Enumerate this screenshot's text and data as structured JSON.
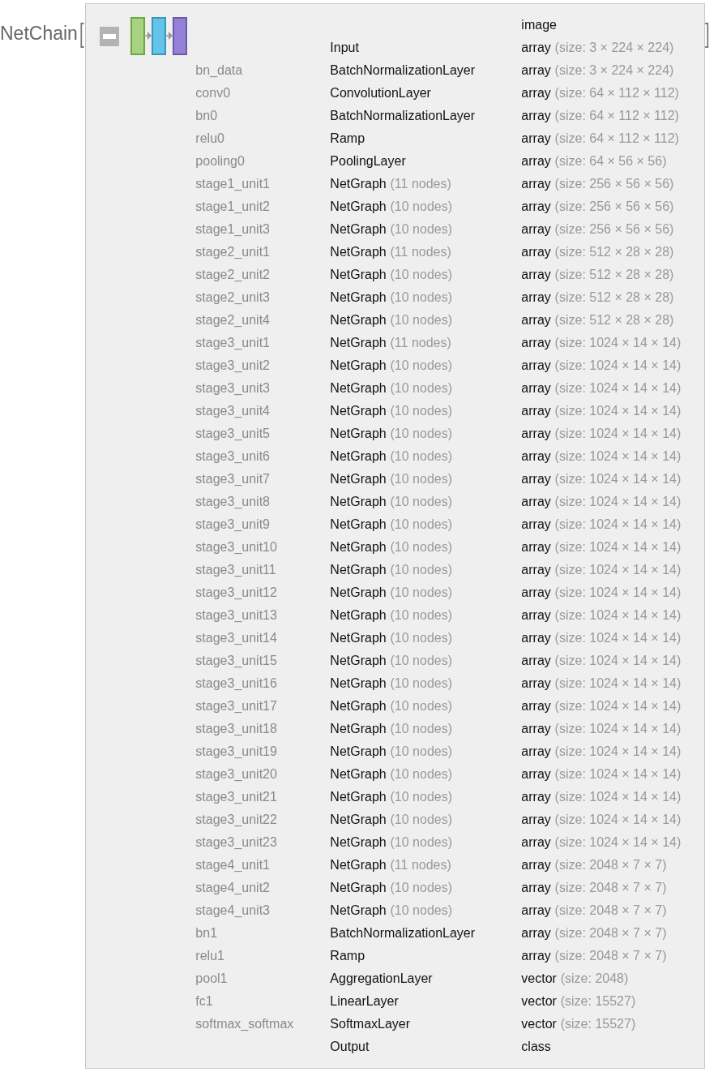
{
  "title": "NetChain",
  "open_bracket": "[",
  "close_bracket": "]",
  "expanded": true,
  "rows": [
    {
      "shape": "image"
    },
    {
      "type": "Input",
      "shape": "array",
      "shape_note": "(size: 3 × 224 × 224)"
    },
    {
      "name": "bn_data",
      "type": "BatchNormalizationLayer",
      "shape": "array",
      "shape_note": "(size: 3 × 224 × 224)"
    },
    {
      "name": "conv0",
      "type": "ConvolutionLayer",
      "shape": "array",
      "shape_note": "(size: 64 × 112 × 112)"
    },
    {
      "name": "bn0",
      "type": "BatchNormalizationLayer",
      "shape": "array",
      "shape_note": "(size: 64 × 112 × 112)"
    },
    {
      "name": "relu0",
      "type": "Ramp",
      "shape": "array",
      "shape_note": "(size: 64 × 112 × 112)"
    },
    {
      "name": "pooling0",
      "type": "PoolingLayer",
      "shape": "array",
      "shape_note": "(size: 64 × 56 × 56)"
    },
    {
      "name": "stage1_unit1",
      "type": "NetGraph",
      "type_note": "(11 nodes)",
      "shape": "array",
      "shape_note": "(size: 256 × 56 × 56)"
    },
    {
      "name": "stage1_unit2",
      "type": "NetGraph",
      "type_note": "(10 nodes)",
      "shape": "array",
      "shape_note": "(size: 256 × 56 × 56)"
    },
    {
      "name": "stage1_unit3",
      "type": "NetGraph",
      "type_note": "(10 nodes)",
      "shape": "array",
      "shape_note": "(size: 256 × 56 × 56)"
    },
    {
      "name": "stage2_unit1",
      "type": "NetGraph",
      "type_note": "(11 nodes)",
      "shape": "array",
      "shape_note": "(size: 512 × 28 × 28)"
    },
    {
      "name": "stage2_unit2",
      "type": "NetGraph",
      "type_note": "(10 nodes)",
      "shape": "array",
      "shape_note": "(size: 512 × 28 × 28)"
    },
    {
      "name": "stage2_unit3",
      "type": "NetGraph",
      "type_note": "(10 nodes)",
      "shape": "array",
      "shape_note": "(size: 512 × 28 × 28)"
    },
    {
      "name": "stage2_unit4",
      "type": "NetGraph",
      "type_note": "(10 nodes)",
      "shape": "array",
      "shape_note": "(size: 512 × 28 × 28)"
    },
    {
      "name": "stage3_unit1",
      "type": "NetGraph",
      "type_note": "(11 nodes)",
      "shape": "array",
      "shape_note": "(size: 1024 × 14 × 14)"
    },
    {
      "name": "stage3_unit2",
      "type": "NetGraph",
      "type_note": "(10 nodes)",
      "shape": "array",
      "shape_note": "(size: 1024 × 14 × 14)"
    },
    {
      "name": "stage3_unit3",
      "type": "NetGraph",
      "type_note": "(10 nodes)",
      "shape": "array",
      "shape_note": "(size: 1024 × 14 × 14)"
    },
    {
      "name": "stage3_unit4",
      "type": "NetGraph",
      "type_note": "(10 nodes)",
      "shape": "array",
      "shape_note": "(size: 1024 × 14 × 14)"
    },
    {
      "name": "stage3_unit5",
      "type": "NetGraph",
      "type_note": "(10 nodes)",
      "shape": "array",
      "shape_note": "(size: 1024 × 14 × 14)"
    },
    {
      "name": "stage3_unit6",
      "type": "NetGraph",
      "type_note": "(10 nodes)",
      "shape": "array",
      "shape_note": "(size: 1024 × 14 × 14)"
    },
    {
      "name": "stage3_unit7",
      "type": "NetGraph",
      "type_note": "(10 nodes)",
      "shape": "array",
      "shape_note": "(size: 1024 × 14 × 14)"
    },
    {
      "name": "stage3_unit8",
      "type": "NetGraph",
      "type_note": "(10 nodes)",
      "shape": "array",
      "shape_note": "(size: 1024 × 14 × 14)"
    },
    {
      "name": "stage3_unit9",
      "type": "NetGraph",
      "type_note": "(10 nodes)",
      "shape": "array",
      "shape_note": "(size: 1024 × 14 × 14)"
    },
    {
      "name": "stage3_unit10",
      "type": "NetGraph",
      "type_note": "(10 nodes)",
      "shape": "array",
      "shape_note": "(size: 1024 × 14 × 14)"
    },
    {
      "name": "stage3_unit11",
      "type": "NetGraph",
      "type_note": "(10 nodes)",
      "shape": "array",
      "shape_note": "(size: 1024 × 14 × 14)"
    },
    {
      "name": "stage3_unit12",
      "type": "NetGraph",
      "type_note": "(10 nodes)",
      "shape": "array",
      "shape_note": "(size: 1024 × 14 × 14)"
    },
    {
      "name": "stage3_unit13",
      "type": "NetGraph",
      "type_note": "(10 nodes)",
      "shape": "array",
      "shape_note": "(size: 1024 × 14 × 14)"
    },
    {
      "name": "stage3_unit14",
      "type": "NetGraph",
      "type_note": "(10 nodes)",
      "shape": "array",
      "shape_note": "(size: 1024 × 14 × 14)"
    },
    {
      "name": "stage3_unit15",
      "type": "NetGraph",
      "type_note": "(10 nodes)",
      "shape": "array",
      "shape_note": "(size: 1024 × 14 × 14)"
    },
    {
      "name": "stage3_unit16",
      "type": "NetGraph",
      "type_note": "(10 nodes)",
      "shape": "array",
      "shape_note": "(size: 1024 × 14 × 14)"
    },
    {
      "name": "stage3_unit17",
      "type": "NetGraph",
      "type_note": "(10 nodes)",
      "shape": "array",
      "shape_note": "(size: 1024 × 14 × 14)"
    },
    {
      "name": "stage3_unit18",
      "type": "NetGraph",
      "type_note": "(10 nodes)",
      "shape": "array",
      "shape_note": "(size: 1024 × 14 × 14)"
    },
    {
      "name": "stage3_unit19",
      "type": "NetGraph",
      "type_note": "(10 nodes)",
      "shape": "array",
      "shape_note": "(size: 1024 × 14 × 14)"
    },
    {
      "name": "stage3_unit20",
      "type": "NetGraph",
      "type_note": "(10 nodes)",
      "shape": "array",
      "shape_note": "(size: 1024 × 14 × 14)"
    },
    {
      "name": "stage3_unit21",
      "type": "NetGraph",
      "type_note": "(10 nodes)",
      "shape": "array",
      "shape_note": "(size: 1024 × 14 × 14)"
    },
    {
      "name": "stage3_unit22",
      "type": "NetGraph",
      "type_note": "(10 nodes)",
      "shape": "array",
      "shape_note": "(size: 1024 × 14 × 14)"
    },
    {
      "name": "stage3_unit23",
      "type": "NetGraph",
      "type_note": "(10 nodes)",
      "shape": "array",
      "shape_note": "(size: 1024 × 14 × 14)"
    },
    {
      "name": "stage4_unit1",
      "type": "NetGraph",
      "type_note": "(11 nodes)",
      "shape": "array",
      "shape_note": "(size: 2048 × 7 × 7)"
    },
    {
      "name": "stage4_unit2",
      "type": "NetGraph",
      "type_note": "(10 nodes)",
      "shape": "array",
      "shape_note": "(size: 2048 × 7 × 7)"
    },
    {
      "name": "stage4_unit3",
      "type": "NetGraph",
      "type_note": "(10 nodes)",
      "shape": "array",
      "shape_note": "(size: 2048 × 7 × 7)"
    },
    {
      "name": "bn1",
      "type": "BatchNormalizationLayer",
      "shape": "array",
      "shape_note": "(size: 2048 × 7 × 7)"
    },
    {
      "name": "relu1",
      "type": "Ramp",
      "shape": "array",
      "shape_note": "(size: 2048 × 7 × 7)"
    },
    {
      "name": "pool1",
      "type": "AggregationLayer",
      "shape": "vector",
      "shape_note": "(size: 2048)"
    },
    {
      "name": "fc1",
      "type": "LinearLayer",
      "shape": "vector",
      "shape_note": "(size: 15527)"
    },
    {
      "name": "softmax_softmax",
      "type": "SoftmaxLayer",
      "shape": "vector",
      "shape_note": "(size: 15527)"
    },
    {
      "type": "Output",
      "shape": "class"
    }
  ]
}
